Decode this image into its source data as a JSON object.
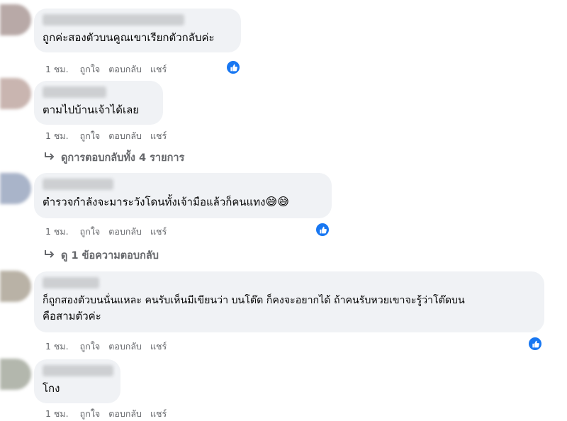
{
  "comments": [
    {
      "text": "ถูกค่ะสองตัวบนคูณเขาเรียกตัวกลับค่ะ",
      "time": "1 ชม.",
      "like": "ถูกใจ",
      "reply": "ตอบกลับ",
      "share": "แชร์",
      "has_reaction": true
    },
    {
      "text": "ตามไปบ้านเจ้าได้เลย",
      "time": "1 ชม.",
      "like": "ถูกใจ",
      "reply": "ตอบกลับ",
      "share": "แชร์",
      "has_reaction": false,
      "replies_link": "ดูการตอบกลับทั้ง 4 รายการ"
    },
    {
      "text": "ตำรวจกำลังจะมาระวังโดนทั้งเจ้ามือแล้วก็คนแทง",
      "emojis": "😅😅",
      "time": "1 ชม.",
      "like": "ถูกใจ",
      "reply": "ตอบกลับ",
      "share": "แชร์",
      "has_reaction": true,
      "replies_link": "ดู 1 ข้อความตอบกลับ"
    },
    {
      "text_line1": "ก็ถูกสองตัวบนนั่นแหละ คนรับเห็นมีเขียนว่า บนโต๊ด ก็คงจะอยากได้ ถ้าคนรับหวยเขาจะรู้ว่าโต๊ดบน",
      "text_line2": "คือสามตัวค่ะ",
      "time": "1 ชม.",
      "like": "ถูกใจ",
      "reply": "ตอบกลับ",
      "share": "แชร์",
      "has_reaction": true
    },
    {
      "text": "โกง",
      "time": "1 ชม.",
      "like": "ถูกใจ",
      "reply": "ตอบกลับ",
      "share": "แชร์",
      "has_reaction": false
    }
  ],
  "icons": {
    "reaction": "thumbs-up-icon",
    "reply_arrow": "reply-arrow-icon"
  },
  "colors": {
    "bubble": "#f0f2f5",
    "meta": "#65676b",
    "like_badge": "#1877f2"
  }
}
